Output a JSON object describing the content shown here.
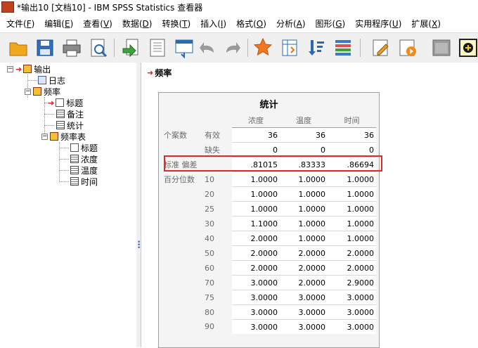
{
  "window": {
    "title": "*输出10 [文档10] - IBM SPSS Statistics 查看器"
  },
  "menu": [
    {
      "label": "文件(",
      "key": "F",
      "end": ")"
    },
    {
      "label": "编辑(",
      "key": "E",
      "end": ")"
    },
    {
      "label": "查看(",
      "key": "V",
      "end": ")"
    },
    {
      "label": "数据(",
      "key": "D",
      "end": ")"
    },
    {
      "label": "转换(",
      "key": "T",
      "end": ")"
    },
    {
      "label": "插入(",
      "key": "I",
      "end": ")"
    },
    {
      "label": "格式(",
      "key": "O",
      "end": ")"
    },
    {
      "label": "分析(",
      "key": "A",
      "end": ")"
    },
    {
      "label": "图形(",
      "key": "G",
      "end": ")"
    },
    {
      "label": "实用程序(",
      "key": "U",
      "end": ")"
    },
    {
      "label": "扩展(",
      "key": "X",
      "end": ")"
    }
  ],
  "toolbar_icons": [
    "open-folder-icon",
    "save-icon",
    "print-icon",
    "print-preview-icon",
    "export-icon",
    "goto-data-icon",
    "goto-case-icon",
    "undo-icon",
    "redo-icon",
    "star-icon",
    "pivot-icon",
    "sort-icon",
    "variables-icon",
    "edit-icon",
    "script-icon",
    "designate-window-icon",
    "add-icon"
  ],
  "tree": {
    "root": "输出",
    "items": [
      "日志",
      "频率",
      "标题",
      "备注",
      "统计",
      "频率表",
      "标题",
      "浓度",
      "温度",
      "时间"
    ]
  },
  "output": {
    "heading": "频率",
    "table": {
      "title": "统计",
      "columns": [
        "浓度",
        "温度",
        "时间"
      ],
      "n_label": "个案数",
      "valid_label": "有效",
      "missing_label": "缺失",
      "sd_label": "标准 偏差",
      "pct_label": "百分位数",
      "valid": [
        "36",
        "36",
        "36"
      ],
      "missing": [
        "0",
        "0",
        "0"
      ],
      "sd": [
        ".81015",
        ".83333",
        ".86694"
      ],
      "percentiles": [
        {
          "p": "10",
          "v": [
            "1.0000",
            "1.0000",
            "1.0000"
          ]
        },
        {
          "p": "20",
          "v": [
            "1.0000",
            "1.0000",
            "1.0000"
          ]
        },
        {
          "p": "25",
          "v": [
            "1.0000",
            "1.0000",
            "1.0000"
          ]
        },
        {
          "p": "30",
          "v": [
            "1.1000",
            "1.0000",
            "1.0000"
          ]
        },
        {
          "p": "40",
          "v": [
            "2.0000",
            "1.0000",
            "1.0000"
          ]
        },
        {
          "p": "50",
          "v": [
            "2.0000",
            "2.0000",
            "2.0000"
          ]
        },
        {
          "p": "60",
          "v": [
            "2.0000",
            "2.0000",
            "2.0000"
          ]
        },
        {
          "p": "70",
          "v": [
            "3.0000",
            "2.0000",
            "2.9000"
          ]
        },
        {
          "p": "75",
          "v": [
            "3.0000",
            "3.0000",
            "3.0000"
          ]
        },
        {
          "p": "80",
          "v": [
            "3.0000",
            "3.0000",
            "3.0000"
          ]
        },
        {
          "p": "90",
          "v": [
            "3.0000",
            "3.0000",
            "3.0000"
          ]
        }
      ]
    }
  },
  "colors": {
    "highlight": "#e02828",
    "accent_arrow": "#e0201c"
  }
}
